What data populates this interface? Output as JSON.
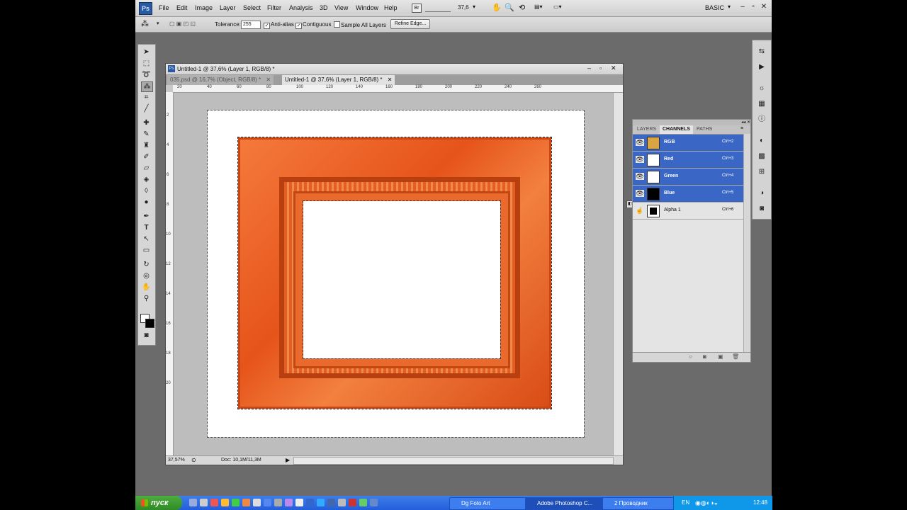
{
  "menubar": {
    "logo": "Ps",
    "items": [
      "File",
      "Edit",
      "Image",
      "Layer",
      "Select",
      "Filter",
      "Analysis",
      "3D",
      "View",
      "Window",
      "Help"
    ],
    "zoom": "37,6",
    "workspace": "BASIC"
  },
  "options": {
    "tolerance_label": "Tolerance:",
    "tolerance_value": "255",
    "anti_alias": "Anti-alias",
    "contiguous": "Contiguous",
    "sample_all": "Sample All Layers",
    "refine_edge": "Refine Edge..."
  },
  "document": {
    "title": "Untitled-1 @ 37,6% (Layer 1, RGB/8) *",
    "tabs": [
      "035.psd @ 16,7% (Object, RGB/8) *",
      "Untitled-1 @ 37,6% (Layer 1, RGB/8) *"
    ],
    "ruler_h": [
      "20",
      "40",
      "60",
      "80",
      "100",
      "120",
      "140",
      "160",
      "180",
      "200",
      "220",
      "240",
      "260"
    ],
    "ruler_v": [
      "2",
      "4",
      "6",
      "8",
      "10",
      "12",
      "14",
      "16",
      "18",
      "20"
    ],
    "status_zoom": "37,57%",
    "status_doc": "Doc: 10,1M/11,3M"
  },
  "panel": {
    "tabs": [
      "LAYERS",
      "CHANNELS",
      "PATHS"
    ],
    "channels": [
      {
        "name": "RGB",
        "key": "Ctrl+2",
        "selected": true,
        "thumb": "#d9a441"
      },
      {
        "name": "Red",
        "key": "Ctrl+3",
        "selected": true,
        "thumb": "#ffffff"
      },
      {
        "name": "Green",
        "key": "Ctrl+4",
        "selected": true,
        "thumb": "#ffffff"
      },
      {
        "name": "Blue",
        "key": "Ctrl+5",
        "selected": true,
        "thumb": "#000000"
      },
      {
        "name": "Alpha 1",
        "key": "Ctrl+6",
        "selected": false,
        "thumb": "#000000"
      }
    ]
  },
  "taskbar": {
    "start": "пуск",
    "buttons": [
      "Dg Foto Art",
      "Adobe Photoshop C...",
      "2 Проводник"
    ],
    "lang": "EN",
    "time": "12:48"
  },
  "colors": {
    "selection": "#3a67c6",
    "frame": "#e6541a"
  }
}
